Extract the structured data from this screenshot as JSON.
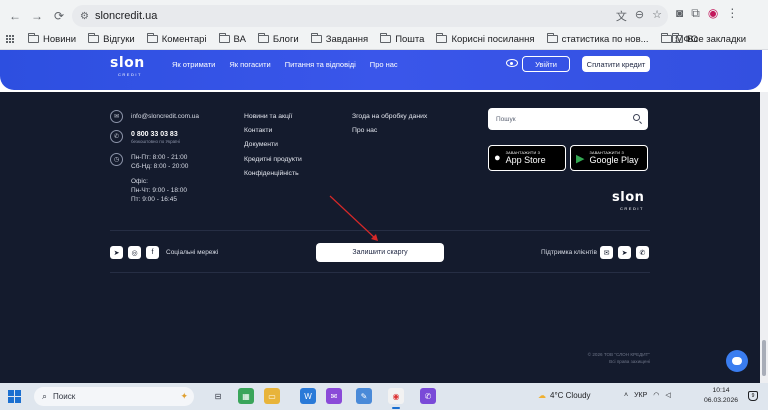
{
  "browser": {
    "url": "sloncredit.ua",
    "bookmarks": [
      "Новини",
      "Відгуки",
      "Коментарі",
      "ВА",
      "Блоги",
      "Завдання",
      "Пошта",
      "Корисні посилання",
      "статистика по нов...",
      "МФО"
    ],
    "all_bookmarks": "Все закладки"
  },
  "header": {
    "logo": "slon",
    "logo_sub": "CREDIT",
    "nav": [
      "Як отримати",
      "Як погасити",
      "Питання та відповіді",
      "Про нас"
    ],
    "login": "Увійти",
    "pay": "Сплатити кредит"
  },
  "footer": {
    "email": "info@sloncredit.com.ua",
    "phone": "0 800 33 03 83",
    "phone_note": "безкоштовно по Україні",
    "hours": [
      "Пн-Пт: 8:00 - 21:00",
      "Сб-Нд: 8:00 - 20:00"
    ],
    "office_label": "Офіс:",
    "office_hours": [
      "Пн-Чт: 9:00 - 18:00",
      "Пт: 9:00 - 16:45"
    ],
    "col1": [
      "Новини та акції",
      "Контакти",
      "Документи",
      "Кредитні продукти",
      "Конфіденційність"
    ],
    "col2": [
      "Згода на обробку даних",
      "Про нас"
    ],
    "search_placeholder": "Пошук",
    "appstore_small": "ЗАВАНТАЖИТИ З",
    "appstore": "App Store",
    "googleplay_small": "ЗАВАНТАЖИТИ З",
    "googleplay": "Google Play",
    "social_label": "Соціальні мережі",
    "complaint": "Залишити скаргу",
    "support": "Підтримка клієнтів",
    "copyright": "© 2026 ТОВ \"СЛОН КРЕДИТ\"",
    "rights": "Всі права захищені"
  },
  "taskbar": {
    "search": "Поиск",
    "weather": "4°C Cloudy",
    "lang": "УКР",
    "time": "10:14",
    "date": "06.03.2026",
    "notifications": "9"
  },
  "colors": {
    "accent": "#3a56ea",
    "footer_bg": "#141b2d",
    "arrow": "#d62828"
  }
}
